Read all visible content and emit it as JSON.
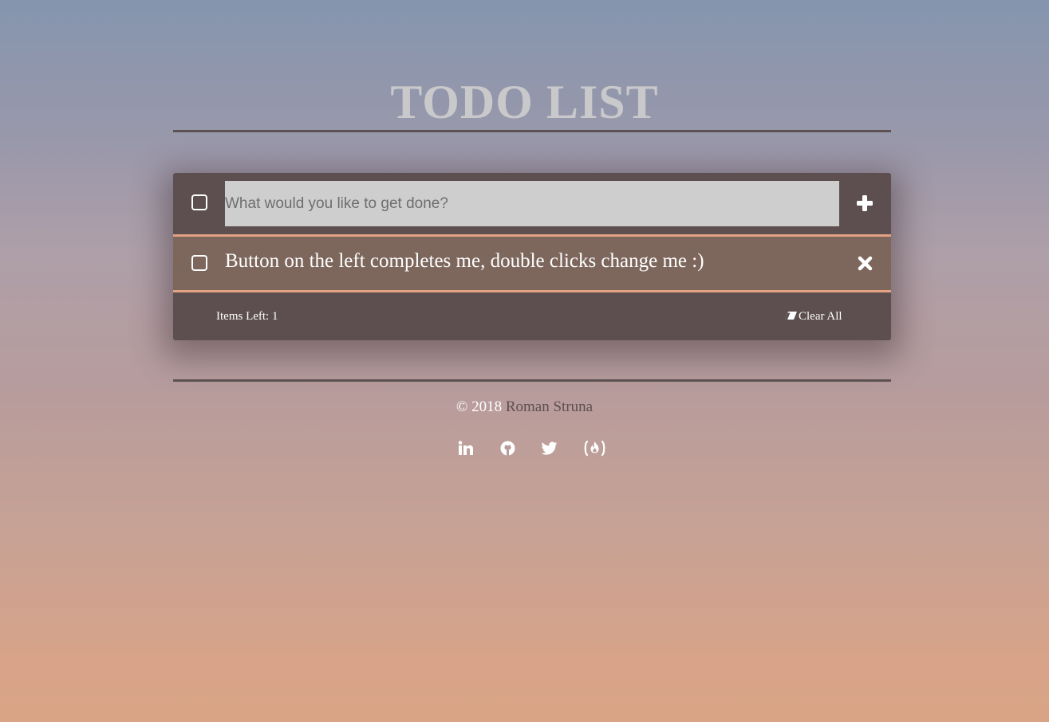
{
  "header": {
    "title": "TODO LIST"
  },
  "input_row": {
    "placeholder": "What would you like to get done?",
    "add_icon": "plus-icon"
  },
  "todos": [
    {
      "text": "Button on the left completes me, double clicks change me :)",
      "completed": false,
      "delete_icon": "close-icon"
    }
  ],
  "footer_bar": {
    "items_left_label": "Items Left: 1",
    "clear_all_label": "Clear All",
    "clear_all_icon": "eraser-icon"
  },
  "page_footer": {
    "copyright_prefix": "© 2018",
    "author": "Roman Struna",
    "social": [
      "linkedin-icon",
      "github-icon",
      "twitter-icon",
      "freecodecamp-icon"
    ]
  },
  "colors": {
    "panel_dark": "#5d4f4f",
    "item_bg": "#7d675d",
    "accent_border": "#e2a283",
    "input_bg": "#cecece",
    "title_color": "#c9c9cb"
  }
}
